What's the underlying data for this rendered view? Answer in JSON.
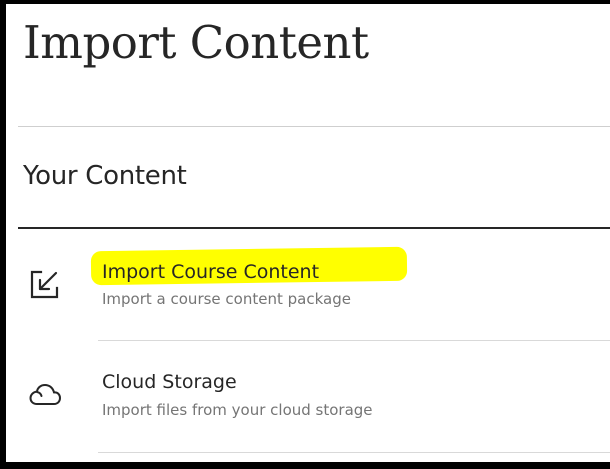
{
  "page": {
    "title": "Import Content"
  },
  "section": {
    "heading": "Your Content"
  },
  "options": [
    {
      "title": "Import Course Content",
      "description": "Import a course content package",
      "icon": "import-arrow-icon",
      "highlighted": true
    },
    {
      "title": "Cloud Storage",
      "description": "Import files from your cloud storage",
      "icon": "cloud-icon",
      "highlighted": false
    }
  ],
  "colors": {
    "text": "#262626",
    "muted": "#757575",
    "divider": "#d9d9d9",
    "highlight": "#ffff00"
  }
}
